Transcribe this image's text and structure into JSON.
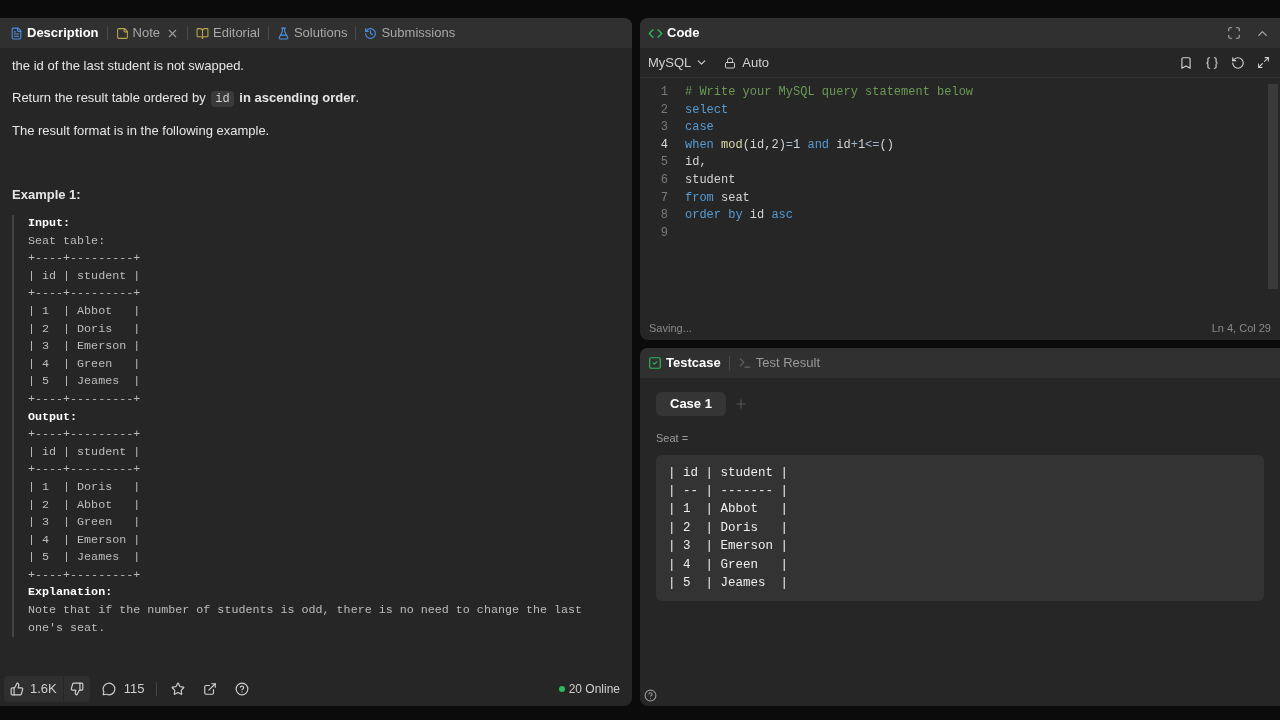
{
  "left_tabs": [
    {
      "label": "Description",
      "kind": "description",
      "selected": true,
      "closable": false
    },
    {
      "label": "Note",
      "kind": "note",
      "selected": false,
      "closable": true
    },
    {
      "label": "Editorial",
      "kind": "editorial",
      "selected": false,
      "closable": false
    },
    {
      "label": "Solutions",
      "kind": "solutions",
      "selected": false,
      "closable": false
    },
    {
      "label": "Submissions",
      "kind": "submissions",
      "selected": false,
      "closable": false
    }
  ],
  "description": {
    "paragraphs": [
      [
        {
          "kind": "text",
          "text": "the id of the last student is not swapped."
        }
      ],
      [
        {
          "kind": "text",
          "text": "Return the result table ordered by "
        },
        {
          "kind": "code",
          "text": "id"
        },
        {
          "kind": "bold",
          "text": " in ascending order"
        },
        {
          "kind": "text",
          "text": "."
        }
      ],
      [
        {
          "kind": "text",
          "text": "The result format is in the following example."
        }
      ]
    ],
    "example_title": "Example 1:",
    "example_blocks": [
      {
        "kind": "label",
        "text": "Input:"
      },
      {
        "kind": "pre",
        "lines": [
          "Seat table:",
          "+----+---------+",
          "| id | student |",
          "+----+---------+",
          "| 1  | Abbot   |",
          "| 2  | Doris   |",
          "| 3  | Emerson |",
          "| 4  | Green   |",
          "| 5  | Jeames  |",
          "+----+---------+"
        ]
      },
      {
        "kind": "label",
        "text": "Output:"
      },
      {
        "kind": "pre",
        "lines": [
          "+----+---------+",
          "| id | student |",
          "+----+---------+",
          "| 1  | Doris   |",
          "| 2  | Abbot   |",
          "| 3  | Green   |",
          "| 4  | Emerson |",
          "| 5  | Jeames  |",
          "+----+---------+"
        ]
      },
      {
        "kind": "label",
        "text": "Explanation:"
      },
      {
        "kind": "text",
        "text": "Note that if the number of students is odd, there is no need to change the last one's seat."
      }
    ]
  },
  "footer": {
    "likes": "1.6K",
    "comments": "115",
    "online": "20 Online"
  },
  "code_panel": {
    "title": "Code",
    "language": "MySQL",
    "mode": "Auto",
    "status": "Saving...",
    "cursor": "Ln 4, Col 29",
    "lines": [
      {
        "number": "1",
        "current": false,
        "tokens": [
          {
            "kind": "comment",
            "text": "# Write your MySQL query statement below"
          }
        ]
      },
      {
        "number": "2",
        "current": false,
        "tokens": [
          {
            "kind": "keyword",
            "text": "select"
          }
        ]
      },
      {
        "number": "3",
        "current": false,
        "tokens": [
          {
            "kind": "keyword",
            "text": "case"
          }
        ]
      },
      {
        "number": "4",
        "current": true,
        "tokens": [
          {
            "kind": "keyword",
            "text": "when "
          },
          {
            "kind": "function",
            "text": "mod"
          },
          {
            "kind": "plain",
            "text": "(id,2)"
          },
          {
            "kind": "operator",
            "text": "="
          },
          {
            "kind": "plain",
            "text": "1 "
          },
          {
            "kind": "keyword",
            "text": "and"
          },
          {
            "kind": "plain",
            "text": " id"
          },
          {
            "kind": "operator",
            "text": "+"
          },
          {
            "kind": "plain",
            "text": "1"
          },
          {
            "kind": "operator",
            "text": "<="
          },
          {
            "kind": "plain",
            "text": "()"
          }
        ]
      },
      {
        "number": "5",
        "current": false,
        "tokens": [
          {
            "kind": "plain",
            "text": "id,"
          }
        ]
      },
      {
        "number": "6",
        "current": false,
        "tokens": [
          {
            "kind": "plain",
            "text": "student"
          }
        ]
      },
      {
        "number": "7",
        "current": false,
        "tokens": [
          {
            "kind": "keyword",
            "text": "from"
          },
          {
            "kind": "plain",
            "text": " seat"
          }
        ]
      },
      {
        "number": "8",
        "current": false,
        "tokens": [
          {
            "kind": "keyword",
            "text": "order by"
          },
          {
            "kind": "plain",
            "text": " id "
          },
          {
            "kind": "keyword",
            "text": "asc"
          }
        ]
      },
      {
        "number": "9",
        "current": false
      }
    ]
  },
  "test_panel": {
    "tabs": [
      {
        "label": "Testcase",
        "kind": "testcase",
        "selected": true
      },
      {
        "label": "Test Result",
        "kind": "result",
        "selected": false
      }
    ],
    "cases": [
      {
        "label": "Case 1",
        "selected": true
      }
    ],
    "input_label": "Seat =",
    "input_lines": [
      "| id | student |",
      "| -- | ------- |",
      "| 1  | Abbot   |",
      "| 2  | Doris   |",
      "| 3  | Emerson |",
      "| 4  | Green   |",
      "| 5  | Jeames  |"
    ]
  }
}
